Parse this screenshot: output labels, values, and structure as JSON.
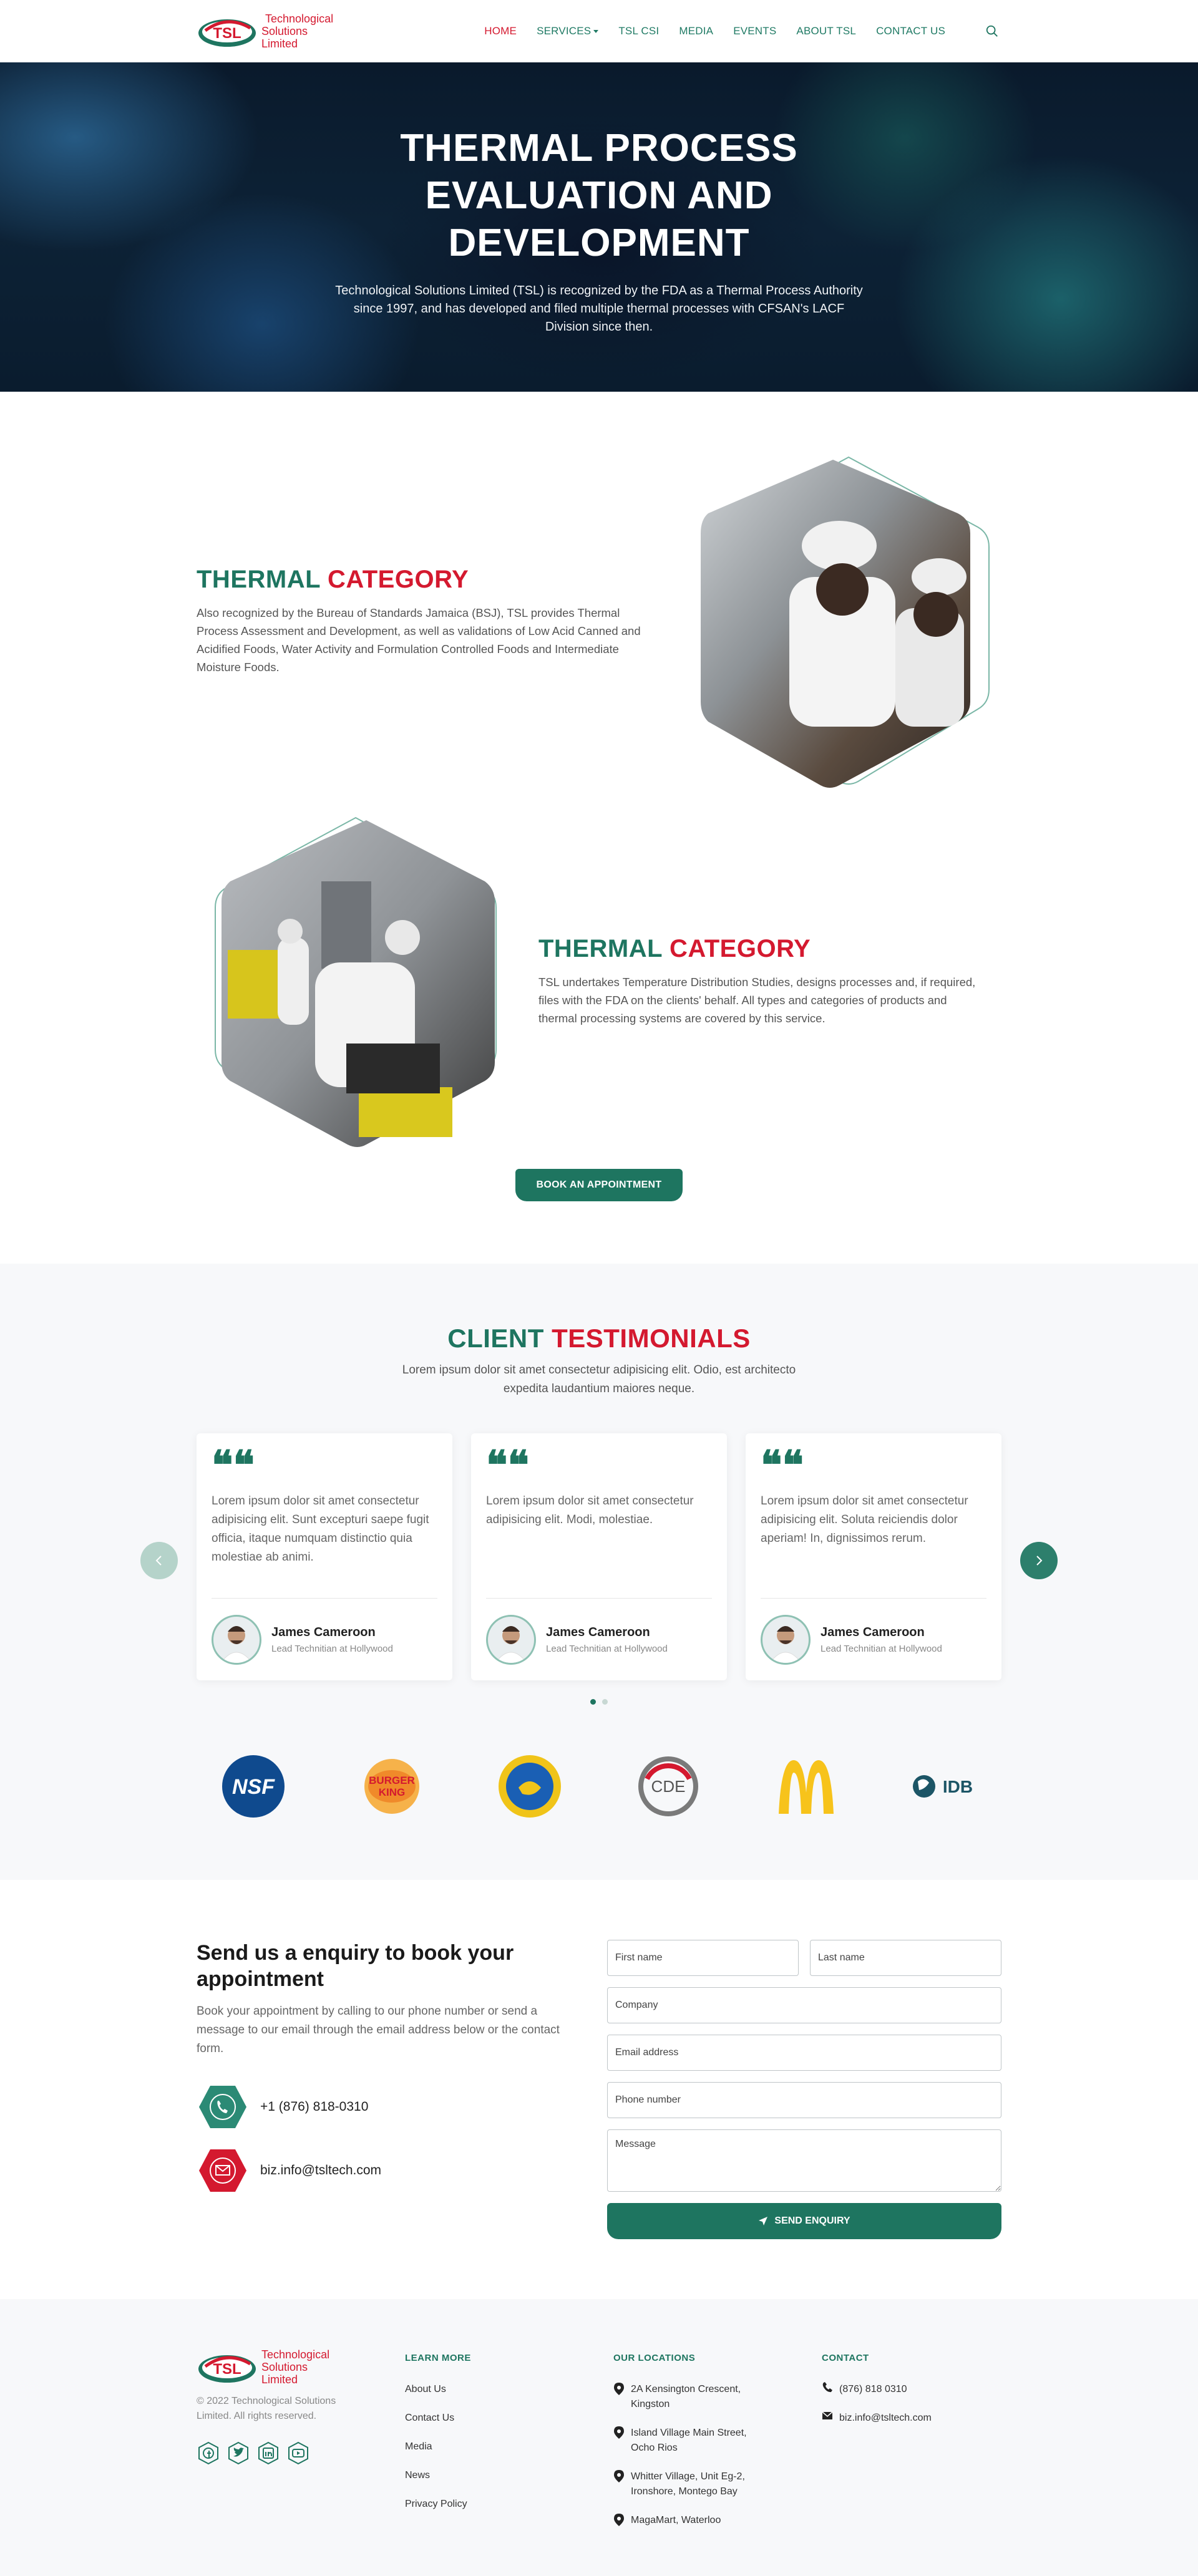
{
  "nav": {
    "logo_text": [
      "Technological",
      "Solutions",
      "Limited"
    ],
    "logo_mark": "TSL",
    "items": [
      {
        "label": "HOME",
        "active": true
      },
      {
        "label": "SERVICES",
        "dropdown": true
      },
      {
        "label": "TSL CSI"
      },
      {
        "label": "MEDIA"
      },
      {
        "label": "EVENTS"
      },
      {
        "label": "ABOUT TSL"
      },
      {
        "label": "CONTACT US"
      }
    ],
    "search_icon": "search-icon"
  },
  "hero": {
    "title": "THERMAL PROCESS EVALUATION AND DEVELOPMENT",
    "text": "Technological Solutions Limited (TSL) is recognized by the FDA as a Thermal Process Authority since 1997, and has developed and filed multiple thermal processes with CFSAN's LACF Division since then."
  },
  "thermal": [
    {
      "title_a": "THERMAL",
      "title_b": "CATEGORY",
      "text": "Also recognized by the Bureau of Standards Jamaica (BSJ), TSL provides Thermal Process Assessment and Development, as well as validations of Low Acid Canned and Acidified Foods, Water Activity and Formulation Controlled Foods and Intermediate Moisture Foods."
    },
    {
      "title_a": "THERMAL",
      "title_b": "CATEGORY",
      "text": "TSL undertakes Temperature Distribution Studies, designs processes and, if required, files with the FDA on the clients' behalf. All types and categories of products and thermal processing systems are covered by this service."
    }
  ],
  "book_button": "BOOK AN APPOINTMENT",
  "testimonials": {
    "title_a": "CLIENT",
    "title_b": "TESTIMONIALS",
    "subtitle": "Lorem ipsum dolor sit amet consectetur adipisicing elit. Odio, est architecto expedita laudantium maiores neque.",
    "cards": [
      {
        "quote": "Lorem ipsum dolor sit amet consectetur adipisicing elit. Sunt excepturi saepe fugit officia, itaque numquam distinctio quia molestiae ab animi.",
        "name": "James Cameroon",
        "role": "Lead Technitian at Hollywood"
      },
      {
        "quote": "Lorem ipsum dolor sit amet consectetur adipisicing elit. Modi, molestiae.",
        "name": "James Cameroon",
        "role": "Lead Technitian at Hollywood"
      },
      {
        "quote": "Lorem ipsum dolor sit amet consectetur adipisicing elit. Soluta reiciendis dolor aperiam! In, dignissimos rerum.",
        "name": "James Cameroon",
        "role": "Lead Technitian at Hollywood"
      }
    ],
    "quote_glyph": "❝❝",
    "page_current": 1,
    "page_total": 2
  },
  "partners": {
    "nsf": "NSF",
    "bk_line1": "BURGER",
    "bk_line2": "KING",
    "cde": "CDE",
    "idb": "IDB",
    "mcd_icon": "mcdonalds-logo",
    "cdb_icon": "development-bank-seal"
  },
  "contact": {
    "title": "Send us a enquiry to book your appointment",
    "text": "Book your appointment by calling to our phone number or send a message to our email through the email address below or the contact form.",
    "phone": "+1 (876) 818-0310",
    "email": "biz.info@tsltech.com",
    "form": {
      "first_name": "First name",
      "last_name": "Last name",
      "company": "Company",
      "email": "Email address",
      "phone": "Phone number",
      "message": "Message",
      "submit": "SEND ENQUIRY"
    }
  },
  "footer": {
    "copyright": "© 2022 Technological Solutions Limited. All rights reserved.",
    "learn_title": "LEARN MORE",
    "learn": [
      "About Us",
      "Contact Us",
      "Media",
      "News",
      "Privacy Policy"
    ],
    "loc_title": "OUR LOCATIONS",
    "locations": [
      "2A Kensington Crescent, Kingston",
      "Island Village Main Street, Ocho Rios",
      "Whitter Village, Unit Eg-2, Ironshore, Montego Bay",
      "MagaMart, Waterloo"
    ],
    "contact_title": "CONTACT",
    "phone": "(876) 818 0310",
    "email": "biz.info@tsltech.com",
    "social": [
      "facebook-icon",
      "twitter-icon",
      "linkedin-icon",
      "youtube-icon"
    ]
  },
  "colors": {
    "brand_green": "#1e7560",
    "brand_red": "#d4192f"
  }
}
